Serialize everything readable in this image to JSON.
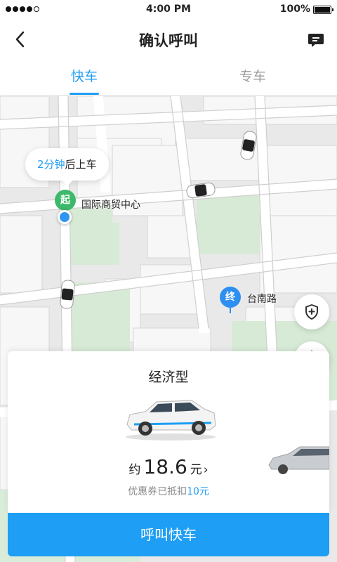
{
  "status_bar": {
    "time": "4:00 PM",
    "battery": "100%"
  },
  "nav": {
    "title": "确认呼叫",
    "back_icon": "chevron-left-icon",
    "message_icon": "message-icon"
  },
  "tabs": [
    {
      "label": "快车",
      "active": true
    },
    {
      "label": "专车",
      "active": false
    }
  ],
  "map": {
    "bubble": {
      "minutes": "2分钟",
      "suffix": "后上车"
    },
    "start": {
      "marker": "起",
      "name": "国际商贸中心"
    },
    "end": {
      "marker": "终",
      "name": "台南路"
    }
  },
  "card": {
    "car_type": "经济型",
    "price": {
      "prefix": "约",
      "amount": "18.6",
      "unit": "元",
      "chevron": "›"
    },
    "discount": {
      "text": "优惠券已抵扣",
      "amount": "10元"
    }
  },
  "call_button": "呼叫快车",
  "colors": {
    "accent": "#1e9ef4",
    "start_green": "#3cb96a",
    "end_blue": "#2d8ff0"
  }
}
